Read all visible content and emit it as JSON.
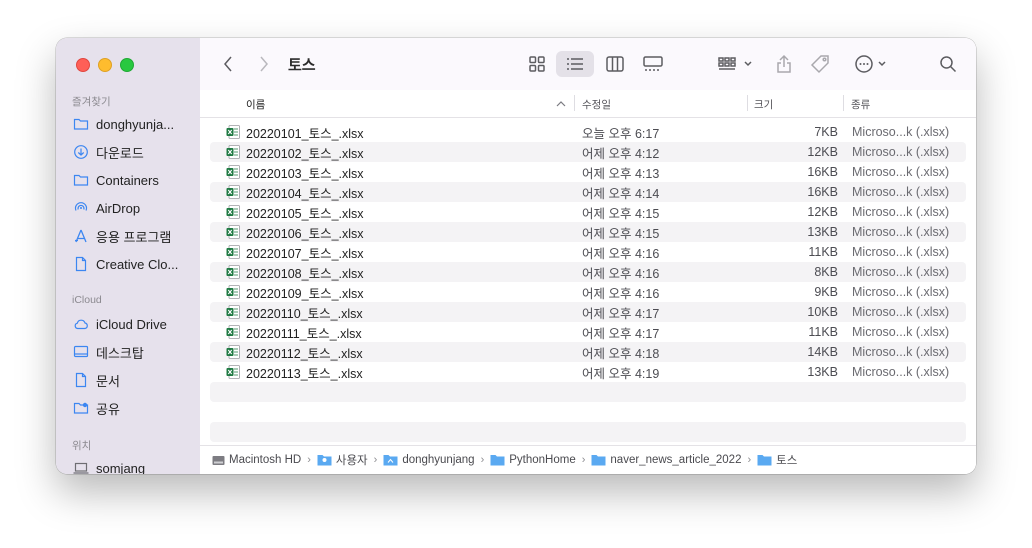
{
  "window": {
    "title": "토스"
  },
  "sidebar": {
    "sections": [
      {
        "label": "즐겨찾기",
        "items": [
          {
            "label": "donghyunja...",
            "icon": "folder-icon"
          },
          {
            "label": "다운로드",
            "icon": "download-icon"
          },
          {
            "label": "Containers",
            "icon": "folder-icon"
          },
          {
            "label": "AirDrop",
            "icon": "airdrop-icon"
          },
          {
            "label": "응용 프로그램",
            "icon": "applications-icon"
          },
          {
            "label": "Creative Clo...",
            "icon": "document-icon"
          }
        ]
      },
      {
        "label": "iCloud",
        "items": [
          {
            "label": "iCloud Drive",
            "icon": "cloud-icon"
          },
          {
            "label": "데스크탑",
            "icon": "desktop-icon"
          },
          {
            "label": "문서",
            "icon": "document-icon"
          },
          {
            "label": "공유",
            "icon": "shared-folder-icon"
          }
        ]
      },
      {
        "label": "위치",
        "items": [
          {
            "label": "somjang",
            "icon": "laptop-icon"
          }
        ]
      }
    ]
  },
  "columns": {
    "name": "이름",
    "date": "수정일",
    "size": "크기",
    "kind": "종류"
  },
  "files": [
    {
      "name": "20220101_토스_.xlsx",
      "date": "오늘 오후 6:17",
      "size": "7KB",
      "kind": "Microso...k (.xlsx)"
    },
    {
      "name": "20220102_토스_.xlsx",
      "date": "어제 오후 4:12",
      "size": "12KB",
      "kind": "Microso...k (.xlsx)"
    },
    {
      "name": "20220103_토스_.xlsx",
      "date": "어제 오후 4:13",
      "size": "16KB",
      "kind": "Microso...k (.xlsx)"
    },
    {
      "name": "20220104_토스_.xlsx",
      "date": "어제 오후 4:14",
      "size": "16KB",
      "kind": "Microso...k (.xlsx)"
    },
    {
      "name": "20220105_토스_.xlsx",
      "date": "어제 오후 4:15",
      "size": "12KB",
      "kind": "Microso...k (.xlsx)"
    },
    {
      "name": "20220106_토스_.xlsx",
      "date": "어제 오후 4:15",
      "size": "13KB",
      "kind": "Microso...k (.xlsx)"
    },
    {
      "name": "20220107_토스_.xlsx",
      "date": "어제 오후 4:16",
      "size": "11KB",
      "kind": "Microso...k (.xlsx)"
    },
    {
      "name": "20220108_토스_.xlsx",
      "date": "어제 오후 4:16",
      "size": "8KB",
      "kind": "Microso...k (.xlsx)"
    },
    {
      "name": "20220109_토스_.xlsx",
      "date": "어제 오후 4:16",
      "size": "9KB",
      "kind": "Microso...k (.xlsx)"
    },
    {
      "name": "20220110_토스_.xlsx",
      "date": "어제 오후 4:17",
      "size": "10KB",
      "kind": "Microso...k (.xlsx)"
    },
    {
      "name": "20220111_토스_.xlsx",
      "date": "어제 오후 4:17",
      "size": "11KB",
      "kind": "Microso...k (.xlsx)"
    },
    {
      "name": "20220112_토스_.xlsx",
      "date": "어제 오후 4:18",
      "size": "14KB",
      "kind": "Microso...k (.xlsx)"
    },
    {
      "name": "20220113_토스_.xlsx",
      "date": "어제 오후 4:19",
      "size": "13KB",
      "kind": "Microso...k (.xlsx)"
    }
  ],
  "pathbar": [
    {
      "label": "Macintosh HD",
      "icon": "hard-drive-icon"
    },
    {
      "label": "사용자",
      "icon": "users-folder-icon"
    },
    {
      "label": "donghyunjang",
      "icon": "home-folder-icon"
    },
    {
      "label": "PythonHome",
      "icon": "folder-icon"
    },
    {
      "label": "naver_news_article_2022",
      "icon": "folder-icon"
    },
    {
      "label": "토스",
      "icon": "folder-icon"
    }
  ],
  "colors": {
    "accent": "#3c86f1",
    "sidebar_bg": "#e6e1ec",
    "excel_green": "#1f7a43"
  }
}
